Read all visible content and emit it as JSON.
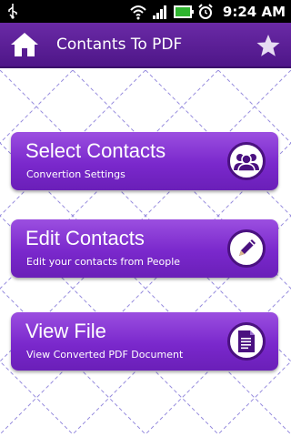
{
  "status_bar": {
    "time": "9:24 AM"
  },
  "app_bar": {
    "title": "Contants To PDF"
  },
  "menu": [
    {
      "title": "Select Contacts",
      "subtitle": "Convertion Settings",
      "icon": "contacts-group-icon"
    },
    {
      "title": "Edit Contacts",
      "subtitle": "Edit your contacts from People",
      "icon": "pencil-icon"
    },
    {
      "title": "View File",
      "subtitle": "View Converted PDF Document",
      "icon": "document-icon"
    }
  ],
  "colors": {
    "accent": "#7a28cc",
    "app_bar": "#5a1c96",
    "pattern": "#6a5bd0"
  }
}
